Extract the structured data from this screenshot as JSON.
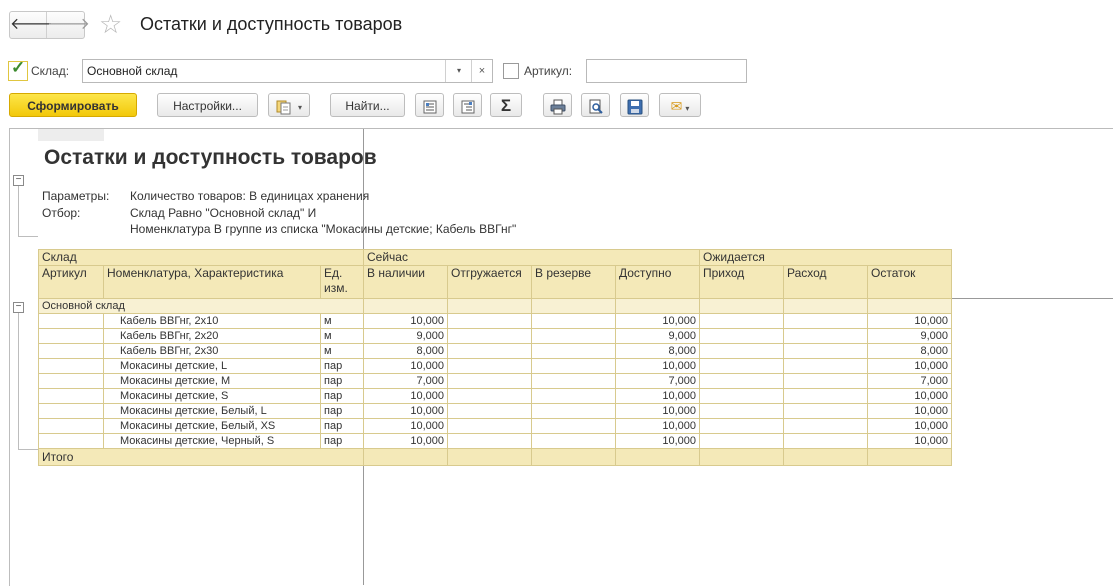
{
  "window": {
    "title": "Остатки и доступность товаров",
    "back_glyph": "🡐",
    "forward_glyph": "🡒",
    "star_glyph": "☆"
  },
  "filters": {
    "warehouse_checked": true,
    "warehouse_label": "Склад:",
    "warehouse_value": "Основной склад",
    "clear_glyph": "×",
    "dropdown_glyph": "▾",
    "article_checked": false,
    "article_label": "Артикул:",
    "article_value": ""
  },
  "toolbar": {
    "generate_label": "Сформировать",
    "settings_label": "Настройки...",
    "find_label": "Найти...",
    "sum_glyph": "Σ",
    "dropdown_glyph": "▾",
    "mail_glyph": "✉",
    "icons": [
      "variants-icon",
      "group-collapse-icon",
      "group-expand-icon",
      "sum-icon",
      "print-icon",
      "preview-icon",
      "save-icon",
      "mail-icon"
    ]
  },
  "report": {
    "title": "Остатки и доступность товаров",
    "params_label": "Параметры:",
    "params_value": "Количество товаров: В единицах хранения",
    "filter_label": "Отбор:",
    "filter_line1": "Склад Равно \"Основной склад\" И",
    "filter_line2": "Номенклатура В группе из списка \"Мокасины детские; Кабель ВВГнг\"",
    "expander_glyph": "−",
    "header": {
      "warehouse": "Склад",
      "now": "Сейчас",
      "expected": "Ожидается",
      "article": "Артикул",
      "nomenclature": "Номенклатура, Характеристика",
      "unit": "Ед. изм.",
      "in_stock": "В наличии",
      "shipping": "Отгружается",
      "reserved": "В резерве",
      "available": "Доступно",
      "incoming": "Приход",
      "outgoing": "Расход",
      "balance": "Остаток"
    },
    "group": "Основной склад",
    "rows": [
      {
        "name": "Кабель ВВГнг, 2х10",
        "unit": "м",
        "in_stock": "10,000",
        "available": "10,000",
        "balance": "10,000"
      },
      {
        "name": "Кабель ВВГнг, 2х20",
        "unit": "м",
        "in_stock": "9,000",
        "available": "9,000",
        "balance": "9,000"
      },
      {
        "name": "Кабель ВВГнг, 2х30",
        "unit": "м",
        "in_stock": "8,000",
        "available": "8,000",
        "balance": "8,000"
      },
      {
        "name": "Мокасины детские, L",
        "unit": "пар",
        "in_stock": "10,000",
        "available": "10,000",
        "balance": "10,000"
      },
      {
        "name": "Мокасины детские, M",
        "unit": "пар",
        "in_stock": "7,000",
        "available": "7,000",
        "balance": "7,000"
      },
      {
        "name": "Мокасины детские, S",
        "unit": "пар",
        "in_stock": "10,000",
        "available": "10,000",
        "balance": "10,000"
      },
      {
        "name": "Мокасины детские, Белый, L",
        "unit": "пар",
        "in_stock": "10,000",
        "available": "10,000",
        "balance": "10,000"
      },
      {
        "name": "Мокасины детские, Белый, XS",
        "unit": "пар",
        "in_stock": "10,000",
        "available": "10,000",
        "balance": "10,000"
      },
      {
        "name": "Мокасины детские, Черный, S",
        "unit": "пар",
        "in_stock": "10,000",
        "available": "10,000",
        "balance": "10,000"
      }
    ],
    "total_label": "Итого"
  },
  "colors": {
    "header_fill": "#f4e9b8",
    "primary_button": "#f6d21e"
  }
}
